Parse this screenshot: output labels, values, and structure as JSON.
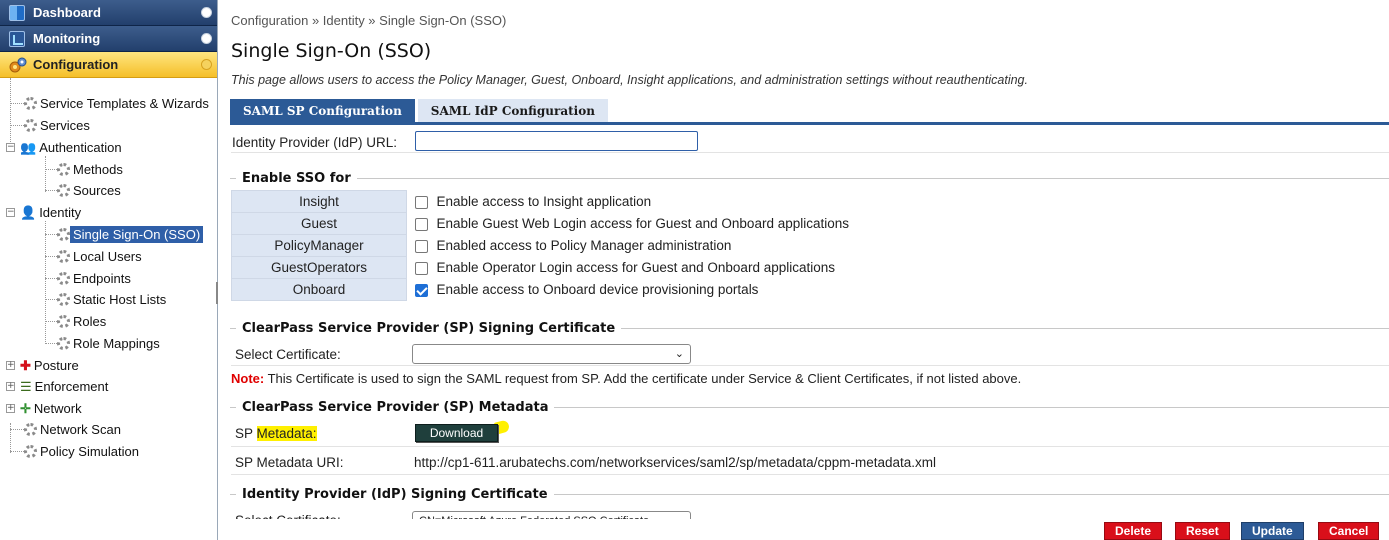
{
  "sidebar": {
    "nav": [
      {
        "label": "Dashboard",
        "icon": "dashboard-icon"
      },
      {
        "label": "Monitoring",
        "icon": "monitoring-icon"
      },
      {
        "label": "Configuration",
        "icon": "configuration-icon"
      }
    ],
    "tree": {
      "service_templates": "Service Templates & Wizards",
      "services": "Services",
      "authentication": "Authentication",
      "methods": "Methods",
      "sources": "Sources",
      "identity": "Identity",
      "sso": "Single Sign-On (SSO)",
      "local_users": "Local Users",
      "endpoints": "Endpoints",
      "static_host_lists": "Static Host Lists",
      "roles": "Roles",
      "role_mappings": "Role Mappings",
      "posture": "Posture",
      "enforcement": "Enforcement",
      "network": "Network",
      "network_scan": "Network Scan",
      "policy_simulation": "Policy Simulation"
    }
  },
  "main": {
    "breadcrumb": "Configuration » Identity » Single Sign-On (SSO)",
    "title": "Single Sign-On (SSO)",
    "description": "This page allows users to access the Policy Manager, Guest, Onboard, Insight applications, and administration settings without reauthenticating.",
    "tabs": [
      {
        "label": "SAML SP Configuration",
        "active": true
      },
      {
        "label": "SAML IdP Configuration",
        "active": false
      }
    ],
    "idp_url_label": "Identity Provider (IdP) URL:",
    "idp_url_value": "",
    "enable_sso": {
      "legend": "Enable SSO for",
      "rows": [
        {
          "app": "Insight",
          "checked": false,
          "desc": "Enable access to Insight application"
        },
        {
          "app": "Guest",
          "checked": false,
          "desc": "Enable Guest Web Login access for Guest and Onboard applications"
        },
        {
          "app": "PolicyManager",
          "checked": false,
          "desc": "Enabled access to Policy Manager administration"
        },
        {
          "app": "GuestOperators",
          "checked": false,
          "desc": "Enable Operator Login access for Guest and Onboard applications"
        },
        {
          "app": "Onboard",
          "checked": true,
          "desc": "Enable access to Onboard device provisioning portals"
        }
      ]
    },
    "sp_signing": {
      "legend": "ClearPass Service Provider (SP) Signing Certificate",
      "select_label": "Select Certificate:",
      "select_value": "",
      "note_prefix": "Note:",
      "note_text": " This Certificate is used to sign the SAML request from SP. Add the certificate under Service & Client Certificates, if not listed above."
    },
    "sp_metadata": {
      "legend": "ClearPass Service Provider (SP) Metadata",
      "label_a": "SP ",
      "label_b": "Metadata:",
      "download_label": "Download",
      "uri_label": "SP Metadata URI:",
      "uri_value": "http://cp1-611.arubatechs.com/networkservices/saml2/sp/metadata/cppm-metadata.xml"
    },
    "idp_signing": {
      "legend": "Identity Provider (IdP) Signing Certificate",
      "select_label": "Select Certificate:",
      "select_value": "CN=Microsoft Azure Federated SSO Certificate"
    },
    "actions": {
      "delete": "Delete",
      "reset": "Reset",
      "update": "Update",
      "cancel": "Cancel"
    }
  },
  "colors": {
    "accent": "#2c5a96",
    "danger": "#d90f1a",
    "highlight": "#fff000",
    "config_active": "#f5bf29"
  }
}
